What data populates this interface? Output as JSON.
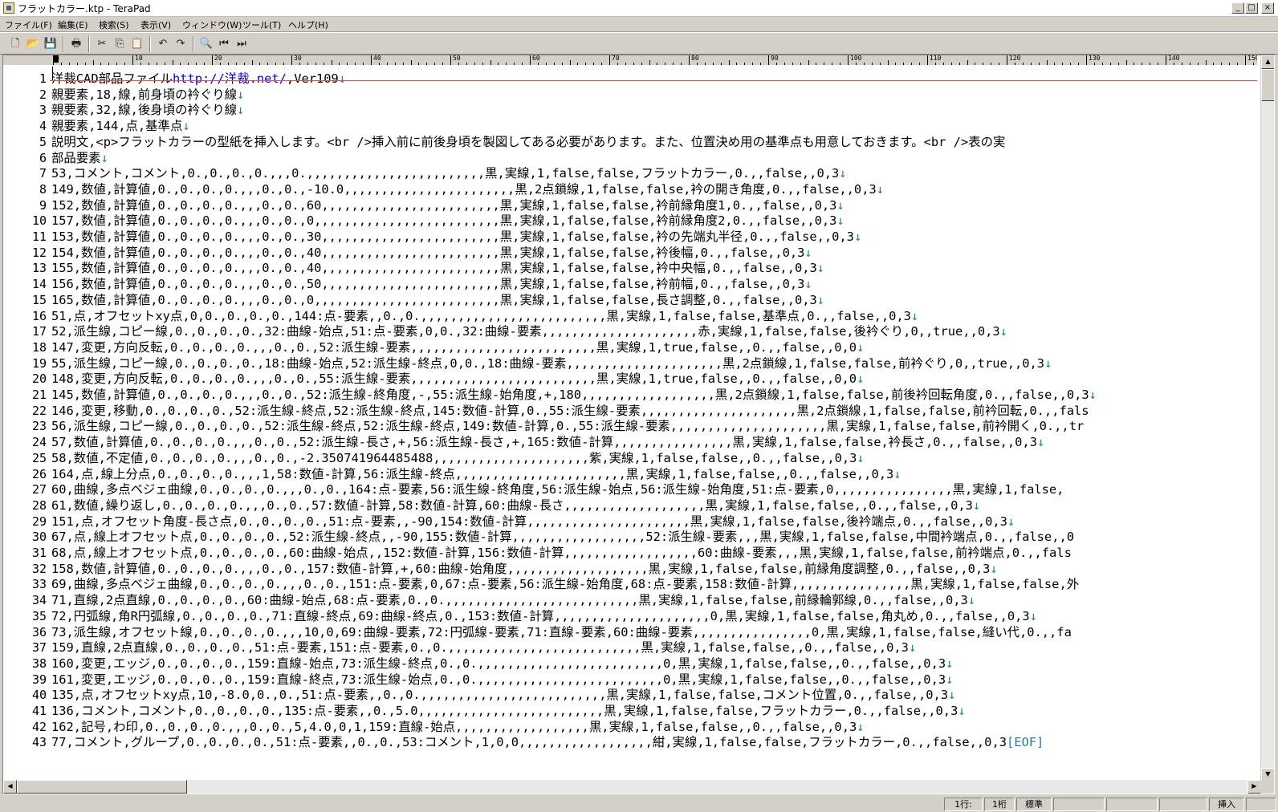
{
  "window": {
    "title": "フラットカラー.ktp - TeraPad",
    "minimize_glyph": "_",
    "restore_glyph": "□",
    "close_glyph": "×"
  },
  "menu": [
    "ファイル(F)",
    "編集(E)",
    "検索(S)",
    "表示(V)",
    "ウィンドウ(W)",
    "ツール(T)",
    "ヘルプ(H)"
  ],
  "toolbar": {
    "icons": [
      "new-file-icon",
      "open-folder-icon",
      "save-icon",
      "print-icon",
      "cut-icon",
      "copy-icon",
      "paste-icon",
      "undo-icon",
      "redo-icon",
      "find-icon",
      "find-prev-icon",
      "find-next-icon"
    ],
    "glyphs": [
      "🗋",
      "📂",
      "💾",
      "🖶",
      "✂",
      "⎘",
      "📋",
      "↶",
      "↷",
      "🔍",
      "⏮",
      "⏭"
    ]
  },
  "ruler": {
    "labels": [
      "0",
      "10",
      "20",
      "30",
      "40",
      "50",
      "60",
      "70",
      "80",
      "90",
      "100",
      "110",
      "120",
      "130",
      "140",
      "150"
    ]
  },
  "editor": {
    "line_numbers": [
      "1",
      "2",
      "3",
      "4",
      "5",
      "6",
      "7",
      "8",
      "9",
      "10",
      "11",
      "12",
      "13",
      "14",
      "15",
      "16",
      "17",
      "18",
      "19",
      "20",
      "21",
      "22",
      "23",
      "24",
      "25",
      "26",
      "27",
      "28",
      "29",
      "30",
      "31",
      "32",
      "33",
      "34",
      "35",
      "36",
      "37",
      "38",
      "39",
      "40",
      "41",
      "42",
      "43"
    ],
    "line1": {
      "before": "洋裁CAD部品ファイル",
      "url": "http://洋裁.net/",
      "after": ",Ver109"
    },
    "lines": [
      "親要素,18,線,前身頃の衿ぐり線",
      "親要素,32,線,後身頃の衿ぐり線",
      "親要素,144,点,基準点",
      "説明文,<p>フラットカラーの型紙を挿入します。<br />挿入前に前後身頃を製図してある必要があります。また、位置決め用の基準点も用意しておきます。<br />表の実",
      "部品要素",
      "53,コメント,コメント,0.,0.,0.,0.,,,0.,,,,,,,,,,,,,,,,,,,,,,,,黒,実線,1,false,false,フラットカラー,0.,,false,,0,3",
      "149,数値,計算値,0.,0.,0.,0.,,,0.,0.,-10.0,,,,,,,,,,,,,,,,,,,,,,,黒,2点鎖線,1,false,false,衿の開き角度,0.,,false,,0,3",
      "152,数値,計算値,0.,0.,0.,0.,,,0.,0.,60,,,,,,,,,,,,,,,,,,,,,,,,黒,実線,1,false,false,衿前縁角度1,0.,,false,,0,3",
      "157,数値,計算値,0.,0.,0.,0.,,,0.,0.,0,,,,,,,,,,,,,,,,,,,,,,,,,黒,実線,1,false,false,衿前縁角度2,0.,,false,,0,3",
      "153,数値,計算値,0.,0.,0.,0.,,,0.,0.,30,,,,,,,,,,,,,,,,,,,,,,,,黒,実線,1,false,false,衿の先端丸半径,0.,,false,,0,3",
      "154,数値,計算値,0.,0.,0.,0.,,,0.,0.,40,,,,,,,,,,,,,,,,,,,,,,,,黒,実線,1,false,false,衿後幅,0.,,false,,0,3",
      "155,数値,計算値,0.,0.,0.,0.,,,0.,0.,40,,,,,,,,,,,,,,,,,,,,,,,,黒,実線,1,false,false,衿中央幅,0.,,false,,0,3",
      "156,数値,計算値,0.,0.,0.,0.,,,0.,0.,50,,,,,,,,,,,,,,,,,,,,,,,,黒,実線,1,false,false,衿前幅,0.,,false,,0,3",
      "165,数値,計算値,0.,0.,0.,0.,,,0.,0.,0,,,,,,,,,,,,,,,,,,,,,,,,,黒,実線,1,false,false,長さ調整,0.,,false,,0,3",
      "51,点,オフセットxy点,0,0.,0.,0.,0.,144:点-要素,,0.,0.,,,,,,,,,,,,,,,,,,,,,,,,,黒,実線,1,false,false,基準点,0.,,false,,0,3",
      "52,派生線,コピー線,0.,0.,0.,0.,32:曲線-始点,51:点-要素,0,0.,32:曲線-要素,,,,,,,,,,,,,,,,,,,,,赤,実線,1,false,false,後衿ぐり,0,,true,,0,3",
      "147,変更,方向反転,0.,0.,0.,0.,,,0.,0.,52:派生線-要素,,,,,,,,,,,,,,,,,,,,,,,,,黒,実線,1,true,false,,0.,,false,,0,0",
      "55,派生線,コピー線,0.,0.,0.,0.,18:曲線-始点,52:派生線-終点,0,0.,18:曲線-要素,,,,,,,,,,,,,,,,,,,,,黒,2点鎖線,1,false,false,前衿ぐり,0,,true,,0,3",
      "148,変更,方向反転,0.,0.,0.,0.,,,0.,0.,55:派生線-要素,,,,,,,,,,,,,,,,,,,,,,,,,黒,実線,1,true,false,,0.,,false,,0,0",
      "145,数値,計算値,0.,0.,0.,0.,,,0.,0.,52:派生線-終角度,-,55:派生線-始角度,+,180,,,,,,,,,,,,,,,,,,黒,2点鎖線,1,false,false,前後衿回転角度,0.,,false,,0,3",
      "146,変更,移動,0.,0.,0.,0.,52:派生線-終点,52:派生線-終点,145:数値-計算,0.,55:派生線-要素,,,,,,,,,,,,,,,,,,,,,黒,2点鎖線,1,false,false,前衿回転,0.,,fals",
      "56,派生線,コピー線,0.,0.,0.,0.,52:派生線-終点,52:派生線-終点,149:数値-計算,0.,55:派生線-要素,,,,,,,,,,,,,,,,,,,,,黒,実線,1,false,false,前衿開く,0.,,tr",
      "57,数値,計算値,0.,0.,0.,0.,,,0.,0.,52:派生線-長さ,+,56:派生線-長さ,+,165:数値-計算,,,,,,,,,,,,,,,,黒,実線,1,false,false,衿長さ,0.,,false,,0,3",
      "58,数値,不定値,0.,0.,0.,0.,,,0.,0.,-2.350741964485488,,,,,,,,,,,,,,,,,,,,,紫,実線,1,false,false,,0.,,false,,0,3",
      "164,点,線上分点,0.,0.,0.,0.,,,1,58:数値-計算,56:派生線-終点,,,,,,,,,,,,,,,,,,,,,,,黒,実線,1,false,false,,0.,,false,,0,3",
      "60,曲線,多点ベジェ曲線,0.,0.,0.,0.,,,0.,0.,164:点-要素,56:派生線-終角度,56:派生線-始点,56:派生線-始角度,51:点-要素,0,,,,,,,,,,,,,,,,黒,実線,1,false,",
      "61,数値,繰り返し,0.,0.,0.,0.,,,0.,0.,57:数値-計算,58:数値-計算,60:曲線-長さ,,,,,,,,,,,,,,,,,,,黒,実線,1,false,false,,0.,,false,,0,3",
      "151,点,オフセット角度-長さ点,0.,0.,0.,0.,51:点-要素,,-90,154:数値-計算,,,,,,,,,,,,,,,,,,,,,,黒,実線,1,false,false,後衿端点,0.,,false,,0,3",
      "67,点,線上オフセット点,0.,0.,0.,0.,52:派生線-終点,,-90,155:数値-計算,,,,,,,,,,,,,,,,,,52:派生線-要素,,,黒,実線,1,false,false,中間衿端点,0.,,false,,0",
      "68,点,線上オフセット点,0.,0.,0.,0.,60:曲線-始点,,152:数値-計算,156:数値-計算,,,,,,,,,,,,,,,,,,60:曲線-要素,,,黒,実線,1,false,false,前衿端点,0.,,fals",
      "158,数値,計算値,0.,0.,0.,0.,,,0.,0.,157:数値-計算,+,60:曲線-始角度,,,,,,,,,,,,,,,,,,,黒,実線,1,false,false,前縁角度調整,0.,,false,,0,3",
      "69,曲線,多点ベジェ曲線,0.,0.,0.,0.,,,0.,0.,151:点-要素,0,67:点-要素,56:派生線-始角度,68:点-要素,158:数値-計算,,,,,,,,,,,,,,,,黒,実線,1,false,false,外",
      "71,直線,2点直線,0.,0.,0.,0.,60:曲線-始点,68:点-要素,0.,0.,,,,,,,,,,,,,,,,,,,,,,,,,,黒,実線,1,false,false,前縁輪郭線,0.,,false,,0,3",
      "72,円弧線,角R円弧線,0.,0.,0.,0.,71:直線-終点,69:曲線-終点,0.,153:数値-計算,,,,,,,,,,,,,,,,,,,,,0,黒,実線,1,false,false,角丸め,0.,,false,,0,3",
      "73,派生線,オフセット線,0.,0.,0.,0.,,,10,0,69:曲線-要素,72:円弧線-要素,71:直線-要素,60:曲線-要素,,,,,,,,,,,,,,,,0,黒,実線,1,false,false,縫い代,0.,,fa",
      "159,直線,2点直線,0.,0.,0.,0.,51:点-要素,151:点-要素,0.,0.,,,,,,,,,,,,,,,,,,,,,,,,,,黒,実線,1,false,false,,0.,,false,,0,3",
      "160,変更,エッジ,0.,0.,0.,0.,159:直線-始点,73:派生線-終点,0.,0.,,,,,,,,,,,,,,,,,,,,,,,,,0,黒,実線,1,false,false,,0.,,false,,0,3",
      "161,変更,エッジ,0.,0.,0.,0.,159:直線-終点,73:派生線-始点,0.,0.,,,,,,,,,,,,,,,,,,,,,,,,,0,黒,実線,1,false,false,,0.,,false,,0,3",
      "135,点,オフセットxy点,10,-8.0,0.,0.,51:点-要素,,0.,0.,,,,,,,,,,,,,,,,,,,,,,,,,黒,実線,1,false,false,コメント位置,0.,,false,,0,3",
      "136,コメント,コメント,0.,0.,0.,0.,135:点-要素,,0.,5.0,,,,,,,,,,,,,,,,,,,,,,,,,黒,実線,1,false,false,フラットカラー,0.,,false,,0,3",
      "162,記号,わ印,0.,0.,0.,0.,,,0.,0.,5,4.0,0,1,159:直線-始点,,,,,,,,,,,,,,,,,,黒,実線,1,false,false,,0.,,false,,0,3",
      "77,コメント,グループ,0.,0.,0.,0.,51:点-要素,,0.,0.,53:コメント,1,0,0,,,,,,,,,,,,,,,,,,紺,実線,1,false,false,フラットカラー,0.,,false,,0,3"
    ],
    "eol_lines": [
      0,
      1,
      2,
      3,
      5,
      6,
      7,
      8,
      9,
      10,
      11,
      12,
      13,
      14,
      15,
      16,
      17,
      18,
      19,
      20,
      23,
      24,
      25,
      27,
      28,
      31,
      33,
      34,
      36,
      37,
      38,
      39,
      40,
      41
    ],
    "eol_mark": "↓",
    "eof_mark": "[EOF]"
  },
  "status": {
    "row": "1行:",
    "col": "1桁",
    "mode": "標準",
    "insert": "挿入"
  }
}
